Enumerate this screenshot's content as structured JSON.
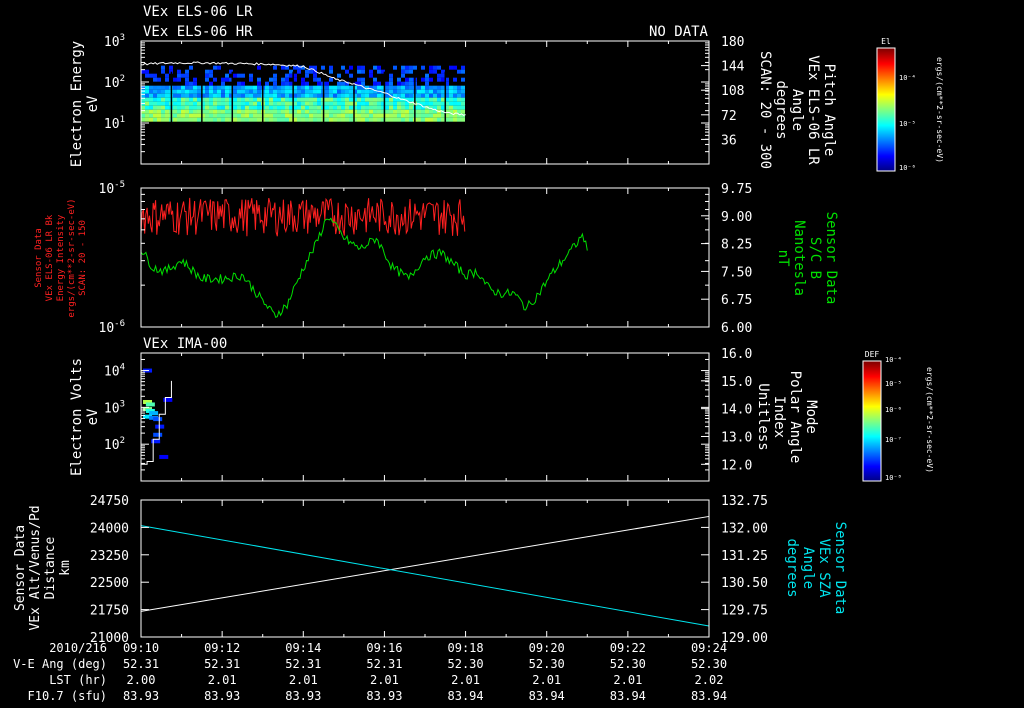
{
  "chart_data": [
    {
      "type": "heatmap",
      "title_lines": [
        "VEx ELS-06 LR",
        "VEx ELS-06 HR"
      ],
      "status": "NO DATA",
      "ylabel": [
        "Electron Energy",
        "eV"
      ],
      "ylim": [
        1,
        1000
      ],
      "yscale": "log",
      "yticks": [
        {
          "base": "10",
          "exp": "1",
          "v": 10
        },
        {
          "base": "10",
          "exp": "2",
          "v": 100
        },
        {
          "base": "10",
          "exp": "3",
          "v": 1000
        }
      ],
      "y2label": [
        "Pitch Angle",
        "VEx ELS-06 LR",
        "Angle",
        "degrees",
        "SCAN: 20 - 300"
      ],
      "y2lim": [
        0,
        180
      ],
      "y2ticks": [
        "36",
        "72",
        "108",
        "144",
        "180"
      ],
      "y2tick_values": [
        36,
        72,
        108,
        144,
        180
      ],
      "data_extent_minutes": [
        0,
        8
      ],
      "energy_band_eV": [
        10,
        250
      ],
      "pitch_angle_trace": {
        "x": [
          0,
          0.8,
          1.6,
          2.4,
          3.2,
          4.0,
          4.4,
          4.8,
          5.2,
          5.6,
          6.0,
          6.4,
          6.8,
          7.2,
          7.6,
          8.0
        ],
        "y": [
          146,
          148,
          148,
          147,
          146,
          143,
          134,
          124,
          118,
          110,
          104,
          95,
          88,
          80,
          74,
          72
        ]
      },
      "colorbar": {
        "label": "El",
        "units": "ergs/(cm**2-sr-sec-eV)",
        "ticks": [
          "10⁻⁴",
          "10⁻⁵",
          "10⁻⁶"
        ]
      }
    },
    {
      "type": "line",
      "ylabel": [
        "Sensor Data",
        "VEx ELS-06 LR Bk",
        "Energy Intensity",
        "ergs/(cm**2-sr-sec-eV)",
        "SCAN: 20 - 150"
      ],
      "ylim": [
        1e-06,
        1e-05
      ],
      "yscale": "log",
      "yticks": [
        {
          "base": "10",
          "exp": "-6",
          "v": 1e-06
        },
        {
          "base": "10",
          "exp": "-5",
          "v": 1e-05
        }
      ],
      "y2label": [
        "Sensor Data",
        "S/C B",
        "Nanotesla",
        "nT"
      ],
      "y2lim": [
        6.0,
        9.75
      ],
      "y2ticks": [
        "6.00",
        "6.75",
        "7.50",
        "8.25",
        "9.00",
        "9.75"
      ],
      "series": [
        {
          "color": "#ff2020",
          "x_range": [
            0,
            8
          ],
          "low": 4.5e-06,
          "high": 8.5e-06
        },
        {
          "color": "#00e000",
          "x": [
            0,
            0.3,
            0.6,
            1.0,
            1.5,
            2.0,
            2.5,
            3.0,
            3.3,
            3.6,
            4.0,
            4.3,
            4.6,
            5.0,
            5.4,
            5.8,
            6.2,
            6.6,
            7.0,
            7.4,
            7.8,
            8.0,
            8.3,
            8.6,
            8.9,
            9.2,
            9.5,
            9.8,
            10.1,
            10.4,
            10.7,
            10.9,
            11.0
          ],
          "y": [
            8.1,
            7.6,
            7.5,
            7.8,
            7.3,
            7.3,
            7.4,
            6.7,
            6.3,
            6.6,
            7.6,
            8.2,
            9.0,
            8.4,
            8.1,
            8.4,
            7.6,
            7.3,
            7.9,
            8.0,
            7.6,
            7.4,
            7.5,
            7.0,
            6.9,
            6.9,
            6.5,
            6.9,
            7.4,
            7.8,
            8.2,
            8.5,
            8.0
          ]
        }
      ]
    },
    {
      "type": "heatmap",
      "title": "VEx IMA-00",
      "ylabel": [
        "Electron Volts",
        "eV"
      ],
      "ylim": [
        10,
        30000
      ],
      "yscale": "log",
      "yticks": [
        {
          "base": "10",
          "exp": "2",
          "v": 100
        },
        {
          "base": "10",
          "exp": "3",
          "v": 1000
        },
        {
          "base": "10",
          "exp": "4",
          "v": 10000
        }
      ],
      "y2label": [
        "Mode",
        "Polar Angle",
        "Index",
        "Unitless"
      ],
      "y2lim": [
        11.4,
        16.0
      ],
      "y2ticks": [
        "12.0",
        "13.0",
        "14.0",
        "15.0",
        "16.0"
      ],
      "data_extent_minutes": [
        0,
        0.8
      ],
      "mode_trace": {
        "x": [
          0,
          0.15,
          0.3,
          0.45,
          0.6,
          0.75
        ],
        "y": [
          12.0,
          12.1,
          12.9,
          13.8,
          14.4,
          15.0
        ]
      },
      "colorbar": {
        "label": "DEF",
        "units": "ergs/(cm**2-sr-sec-eV)",
        "ticks": [
          "10⁻⁴",
          "10⁻⁵",
          "10⁻⁶",
          "10⁻⁷",
          "10⁻⁸"
        ]
      }
    },
    {
      "type": "line",
      "ylabel": [
        "Sensor Data",
        "VEx Alt/Venus/Pd",
        "Distance",
        "km"
      ],
      "ylim": [
        21000,
        24750
      ],
      "yticks": [
        "21000",
        "21750",
        "22500",
        "23250",
        "24000",
        "24750"
      ],
      "y2label": [
        "Sensor Data",
        "VEx SZA",
        "Angle",
        "degrees"
      ],
      "y2lim": [
        129.0,
        132.75
      ],
      "y2ticks": [
        "129.00",
        "129.75",
        "130.50",
        "131.25",
        "132.00",
        "132.75"
      ],
      "series": [
        {
          "color": "#ffffff",
          "axis": "left",
          "x": [
            0,
            14
          ],
          "y": [
            21700,
            24300
          ]
        },
        {
          "color": "#00e5ee",
          "axis": "right",
          "x": [
            0,
            14
          ],
          "y": [
            132.05,
            129.3
          ]
        }
      ]
    }
  ],
  "xaxis": {
    "label": "2010/216",
    "ticks": [
      "09:10",
      "09:12",
      "09:14",
      "09:16",
      "09:18",
      "09:20",
      "09:22",
      "09:24"
    ],
    "rows": [
      {
        "label": "V-E Ang (deg)",
        "values": [
          "52.31",
          "52.31",
          "52.31",
          "52.31",
          "52.30",
          "52.30",
          "52.30",
          "52.30"
        ]
      },
      {
        "label": "LST (hr)",
        "values": [
          "2.00",
          "2.01",
          "2.01",
          "2.01",
          "2.01",
          "2.01",
          "2.01",
          "2.02"
        ]
      },
      {
        "label": "F10.7 (sfu)",
        "values": [
          "83.93",
          "83.93",
          "83.93",
          "83.93",
          "83.94",
          "83.94",
          "83.94",
          "83.94"
        ]
      }
    ]
  },
  "colors": {
    "background": "#000000",
    "axis": "#ffffff",
    "red": "#ff2020",
    "green": "#00e000",
    "cyan": "#00e5ee"
  }
}
